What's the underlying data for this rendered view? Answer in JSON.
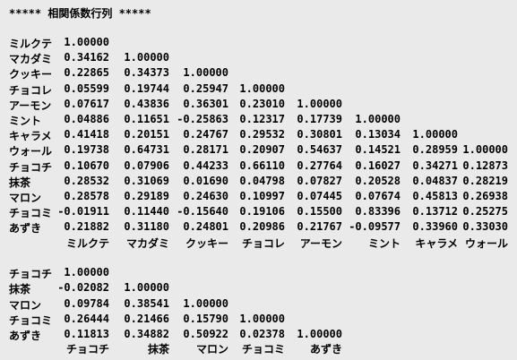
{
  "title": "***** 相関係数行列 *****",
  "matrix1": {
    "rows": [
      {
        "label": "ミルクテ",
        "values": [
          "1.00000"
        ]
      },
      {
        "label": "マカダミ",
        "values": [
          "0.34162",
          "1.00000"
        ]
      },
      {
        "label": "クッキー",
        "values": [
          "0.22865",
          "0.34373",
          "1.00000"
        ]
      },
      {
        "label": "チョコレ",
        "values": [
          "0.05599",
          "0.19744",
          "0.25947",
          "1.00000"
        ]
      },
      {
        "label": "アーモン",
        "values": [
          "0.07617",
          "0.43836",
          "0.36301",
          "0.23010",
          "1.00000"
        ]
      },
      {
        "label": "ミント",
        "values": [
          "0.04886",
          "0.11651",
          "-0.25863",
          "0.12317",
          "0.17739",
          "1.00000"
        ]
      },
      {
        "label": "キャラメ",
        "values": [
          "0.41418",
          "0.20151",
          "0.24767",
          "0.29532",
          "0.30801",
          "0.13034",
          "1.00000"
        ]
      },
      {
        "label": "ウォール",
        "values": [
          "0.19738",
          "0.64731",
          "0.28171",
          "0.20907",
          "0.54637",
          "0.14521",
          "0.28959",
          "1.00000"
        ]
      },
      {
        "label": "チョコチ",
        "values": [
          "0.10670",
          "0.07906",
          "0.44233",
          "0.66110",
          "0.27764",
          "0.16027",
          "0.34271",
          "0.12873"
        ]
      },
      {
        "label": "抹茶",
        "values": [
          "0.28532",
          "0.31069",
          "0.01690",
          "0.04798",
          "0.07827",
          "0.20528",
          "0.04837",
          "0.28219"
        ]
      },
      {
        "label": "マロン",
        "values": [
          "0.28578",
          "0.29189",
          "0.24630",
          "0.10997",
          "0.07445",
          "0.07674",
          "0.45813",
          "0.26938"
        ]
      },
      {
        "label": "チョコミ",
        "values": [
          "-0.01911",
          "0.11440",
          "-0.15640",
          "0.19106",
          "0.15500",
          "0.83396",
          "0.13712",
          "0.25275"
        ]
      },
      {
        "label": "あずき",
        "values": [
          "0.21882",
          "0.31180",
          "0.24801",
          "0.20986",
          "0.21767",
          "-0.09577",
          "0.33960",
          "0.33030"
        ]
      }
    ],
    "column_headers": [
      "ミルクテ",
      "マカダミ",
      "クッキー",
      "チョコレ",
      "アーモン",
      "ミント",
      "キャラメ",
      "ウォール"
    ]
  },
  "matrix2": {
    "rows": [
      {
        "label": "チョコチ",
        "values": [
          "1.00000"
        ]
      },
      {
        "label": "抹茶",
        "values": [
          "-0.02082",
          "1.00000"
        ]
      },
      {
        "label": "マロン",
        "values": [
          "0.09784",
          "0.38541",
          "1.00000"
        ]
      },
      {
        "label": "チョコミ",
        "values": [
          "0.26444",
          "0.21466",
          "0.15790",
          "1.00000"
        ]
      },
      {
        "label": "あずき",
        "values": [
          "0.11813",
          "0.34882",
          "0.50922",
          "0.02378",
          "1.00000"
        ]
      }
    ],
    "column_headers": [
      "チョコチ",
      "抹茶",
      "マロン",
      "チョコミ",
      "あずき"
    ]
  }
}
